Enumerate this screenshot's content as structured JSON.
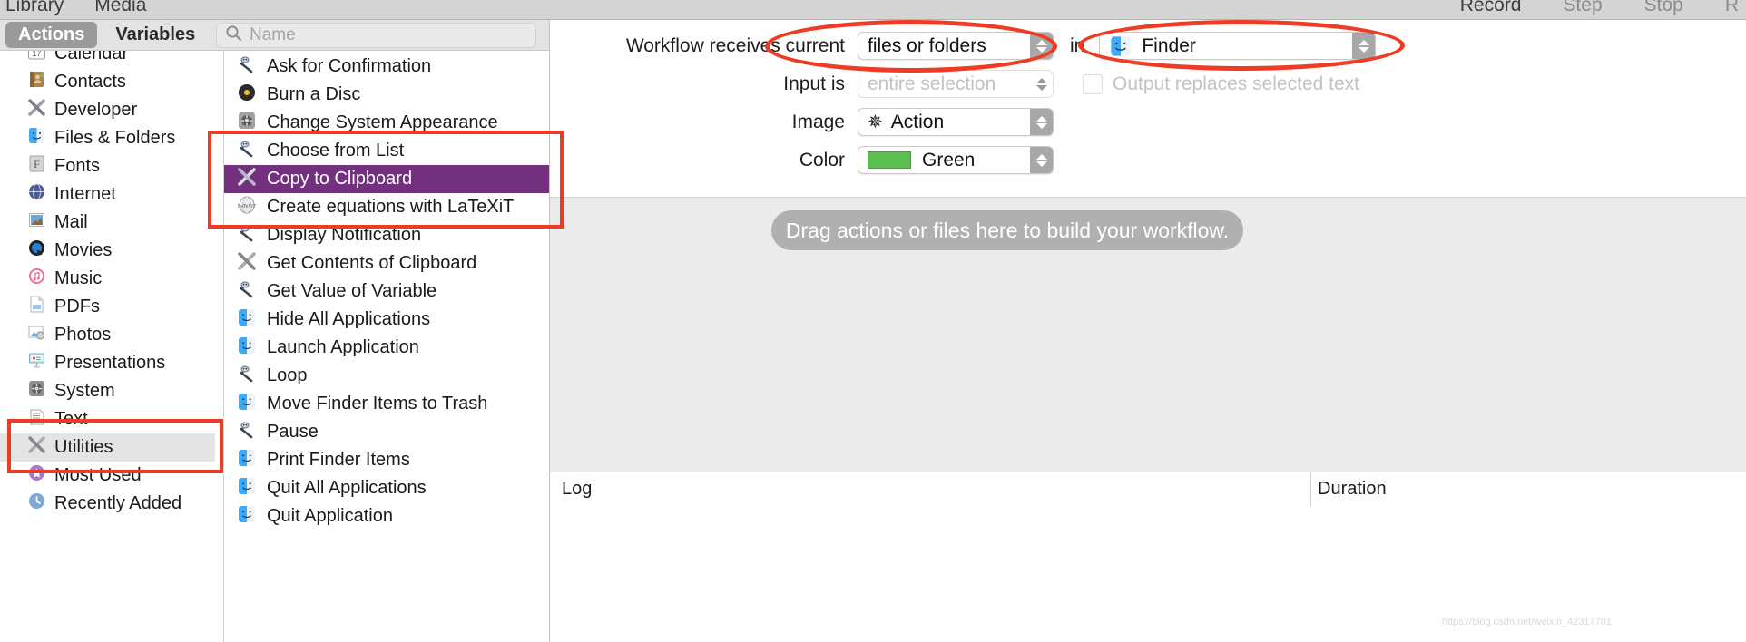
{
  "window": {
    "toolbar_left": [
      "Library",
      "Media"
    ],
    "toolbar_right": [
      {
        "label": "Record",
        "active": true
      },
      {
        "label": "Step",
        "active": false
      },
      {
        "label": "Stop",
        "active": false
      },
      {
        "label": "R",
        "active": false
      }
    ]
  },
  "tabs": [
    {
      "label": "Actions",
      "selected": true
    },
    {
      "label": "Variables",
      "selected": false
    }
  ],
  "search": {
    "placeholder": "Name",
    "value": "",
    "icon": "search-icon"
  },
  "library": {
    "items": [
      {
        "label": "Calendar",
        "icon": "calendar-icon",
        "selected": false
      },
      {
        "label": "Contacts",
        "icon": "contacts-icon",
        "selected": false
      },
      {
        "label": "Developer",
        "icon": "developer-icon",
        "selected": false
      },
      {
        "label": "Files & Folders",
        "icon": "finder-icon",
        "selected": false
      },
      {
        "label": "Fonts",
        "icon": "fonts-icon",
        "selected": false
      },
      {
        "label": "Internet",
        "icon": "internet-icon",
        "selected": false
      },
      {
        "label": "Mail",
        "icon": "mail-icon",
        "selected": false
      },
      {
        "label": "Movies",
        "icon": "movies-icon",
        "selected": false
      },
      {
        "label": "Music",
        "icon": "music-icon",
        "selected": false
      },
      {
        "label": "PDFs",
        "icon": "pdf-icon",
        "selected": false
      },
      {
        "label": "Photos",
        "icon": "photos-icon",
        "selected": false
      },
      {
        "label": "Presentations",
        "icon": "presentations-icon",
        "selected": false
      },
      {
        "label": "System",
        "icon": "system-icon",
        "selected": false
      },
      {
        "label": "Text",
        "icon": "text-icon",
        "selected": false
      },
      {
        "label": "Utilities",
        "icon": "utilities-icon",
        "selected": true
      },
      {
        "label": "Most Used",
        "icon": "most-used-icon",
        "selected": false
      },
      {
        "label": "Recently Added",
        "icon": "recently-added-icon",
        "selected": false
      }
    ]
  },
  "actions": {
    "items": [
      {
        "label": "Ask for Confirmation",
        "icon": "automator-robot-icon",
        "selected": false
      },
      {
        "label": "Burn a Disc",
        "icon": "burn-disc-icon",
        "selected": false
      },
      {
        "label": "Change System Appearance",
        "icon": "system-prefs-icon",
        "selected": false
      },
      {
        "label": "Choose from List",
        "icon": "automator-robot-icon",
        "selected": false
      },
      {
        "label": "Copy to Clipboard",
        "icon": "utilities-icon",
        "selected": true
      },
      {
        "label": "Create equations with LaTeXiT",
        "icon": "latexit-icon",
        "selected": false
      },
      {
        "label": "Display Notification",
        "icon": "automator-robot-icon",
        "selected": false
      },
      {
        "label": "Get Contents of Clipboard",
        "icon": "utilities-icon",
        "selected": false
      },
      {
        "label": "Get Value of Variable",
        "icon": "automator-robot-icon",
        "selected": false
      },
      {
        "label": "Hide All Applications",
        "icon": "finder-icon",
        "selected": false
      },
      {
        "label": "Launch Application",
        "icon": "finder-icon",
        "selected": false
      },
      {
        "label": "Loop",
        "icon": "automator-robot-icon",
        "selected": false
      },
      {
        "label": "Move Finder Items to Trash",
        "icon": "finder-icon",
        "selected": false
      },
      {
        "label": "Pause",
        "icon": "automator-robot-icon",
        "selected": false
      },
      {
        "label": "Print Finder Items",
        "icon": "finder-icon",
        "selected": false
      },
      {
        "label": "Quit All Applications",
        "icon": "finder-icon",
        "selected": false
      },
      {
        "label": "Quit Application",
        "icon": "finder-icon",
        "selected": false
      }
    ]
  },
  "config": {
    "receives_label": "Workflow receives current",
    "receives_value": "files or folders",
    "in_label": "in",
    "in_value": "Finder",
    "in_icon": "finder-icon",
    "input_is_label": "Input is",
    "input_is_value": "entire selection",
    "output_replaces_label": "Output replaces selected text",
    "output_replaces_checked": false,
    "image_label": "Image",
    "image_value": "Action",
    "image_icon": "gear-icon",
    "color_label": "Color",
    "color_value": "Green",
    "color_hex": "#5cbf52"
  },
  "canvas": {
    "drop_hint": "Drag actions or files here to build your workflow."
  },
  "logbar": {
    "log_label": "Log",
    "duration_label": "Duration"
  },
  "annotation": {
    "color": "#ee3b23"
  },
  "watermark": "https://blog.csdn.net/weixin_42317701"
}
